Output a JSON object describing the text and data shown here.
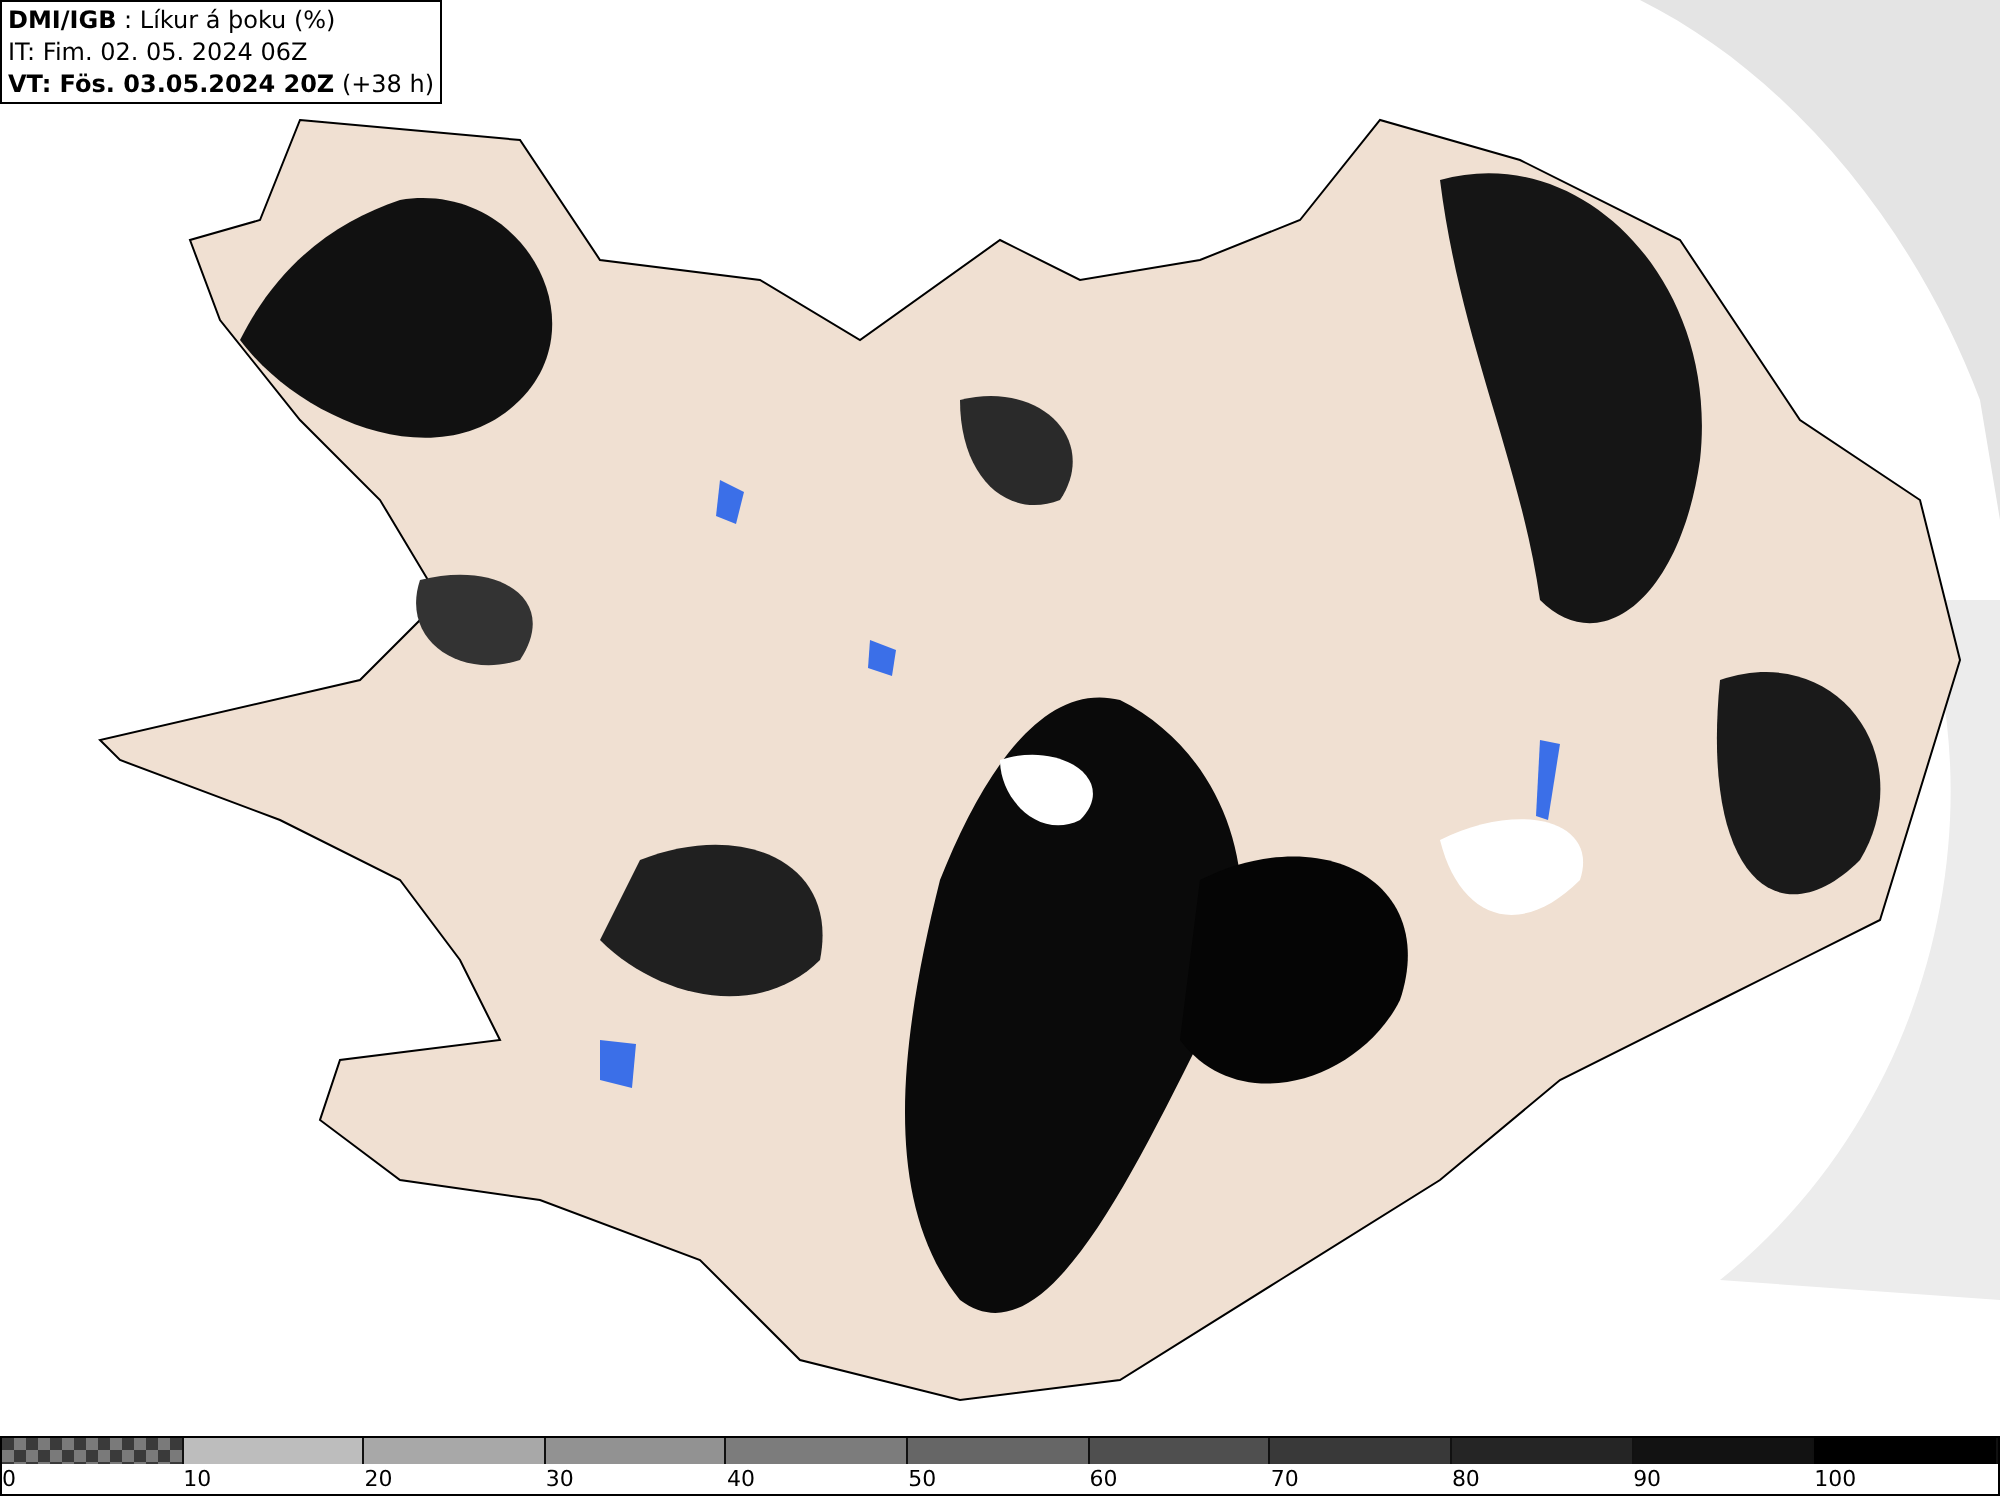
{
  "header": {
    "lines": [
      "**DMI/IGB** : Líkur á þoku (%)",
      "IT: Fim. 02. 05. 2024 06Z",
      "**VT: Fös. 03.05.2024 20Z** (+38 h)"
    ]
  },
  "legend": [
    {
      "label": "0",
      "kind": "checker",
      "color": "#7a7a7a"
    },
    {
      "label": "10",
      "kind": "solid",
      "color": "#bdbdbd"
    },
    {
      "label": "20",
      "kind": "solid",
      "color": "#a8a8a8"
    },
    {
      "label": "30",
      "kind": "solid",
      "color": "#929292"
    },
    {
      "label": "40",
      "kind": "solid",
      "color": "#7c7c7c"
    },
    {
      "label": "50",
      "kind": "solid",
      "color": "#666666"
    },
    {
      "label": "60",
      "kind": "solid",
      "color": "#4f4f4f"
    },
    {
      "label": "70",
      "kind": "solid",
      "color": "#393939"
    },
    {
      "label": "80",
      "kind": "solid",
      "color": "#252525"
    },
    {
      "label": "90",
      "kind": "solid",
      "color": "#121212"
    },
    {
      "label": "100",
      "kind": "solid",
      "color": "#000000"
    }
  ]
}
